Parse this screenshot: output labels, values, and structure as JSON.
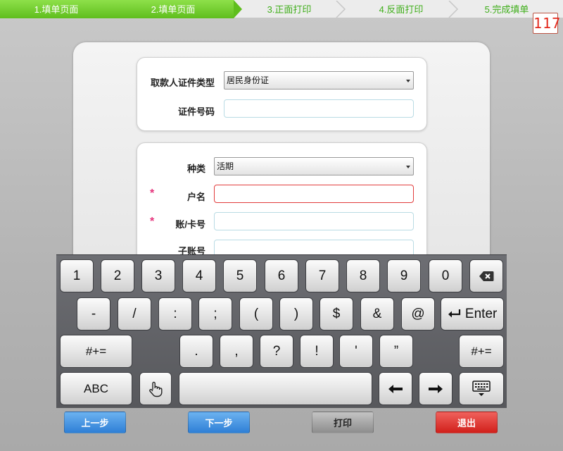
{
  "steps": [
    {
      "label": "1.填单页面",
      "state": "done"
    },
    {
      "label": "2.填单页面",
      "state": "done"
    },
    {
      "label": "3.正面打印",
      "state": "todo"
    },
    {
      "label": "4.反面打印",
      "state": "todo"
    },
    {
      "label": "5.完成填单",
      "state": "todo"
    }
  ],
  "counter": "117",
  "form": {
    "id_type_label": "取款人证件类型",
    "id_type_value": "居民身份证",
    "id_number_label": "证件号码",
    "category_label": "种类",
    "category_value": "活期",
    "account_name_label": "户名",
    "account_number_label": "账/卡号",
    "sub_account_label": "子账号",
    "required_mark": "*"
  },
  "keyboard": {
    "row1": [
      "1",
      "2",
      "3",
      "4",
      "5",
      "6",
      "7",
      "8",
      "9",
      "0"
    ],
    "row2": [
      "-",
      "/",
      ":",
      ";",
      "(",
      ")",
      "$",
      "&",
      "@"
    ],
    "enter_label": "Enter",
    "row3": [
      ".",
      ",",
      "?",
      "!",
      "'",
      "”"
    ],
    "symbols_label": "#+=",
    "abc_label": "ABC"
  },
  "buttons": {
    "prev": "上一步",
    "next": "下一步",
    "print": "打印",
    "exit": "退出"
  },
  "colors": {
    "step_done": "#5fbe1d",
    "step_todo_text": "#3fae1a",
    "required": "#e5337b",
    "error_border": "#e23c3c",
    "btn_blue": "#2f7fd6",
    "btn_red": "#d1201b"
  }
}
